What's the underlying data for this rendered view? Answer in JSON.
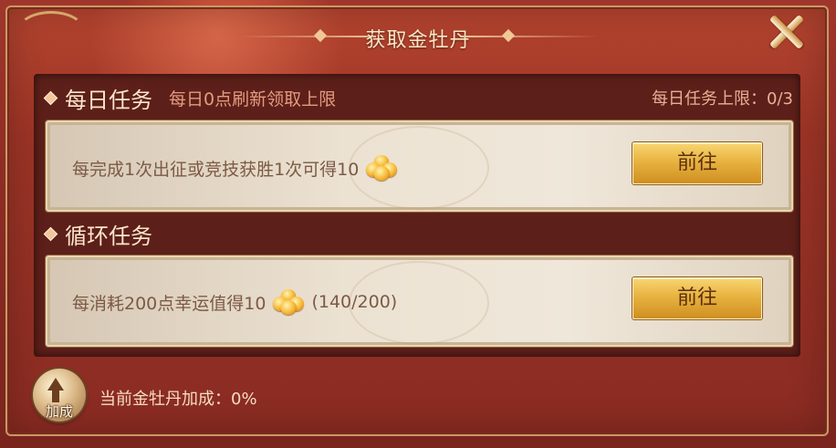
{
  "dialog": {
    "title": "获取金牡丹"
  },
  "daily": {
    "title": "每日任务",
    "subtitle": "每日0点刷新领取上限",
    "limit_text": "每日任务上限：0/3",
    "task": {
      "text": "每完成1次出征或竞技获胜1次可得10",
      "reward_icon": "gold-peony-icon",
      "button_label": "前往"
    }
  },
  "cycle": {
    "title": "循环任务",
    "task": {
      "text": "每消耗200点幸运值得10",
      "reward_icon": "gold-peony-icon",
      "progress_text": "(140/200)",
      "button_label": "前往"
    }
  },
  "bonus": {
    "icon_label": "加成",
    "text": "当前金牡丹加成：0%"
  },
  "colors": {
    "panel_red": "#9c3426",
    "content_dark": "#5d1f19",
    "button_gold": "#e8b340",
    "text_cream": "#fbe6cb"
  }
}
